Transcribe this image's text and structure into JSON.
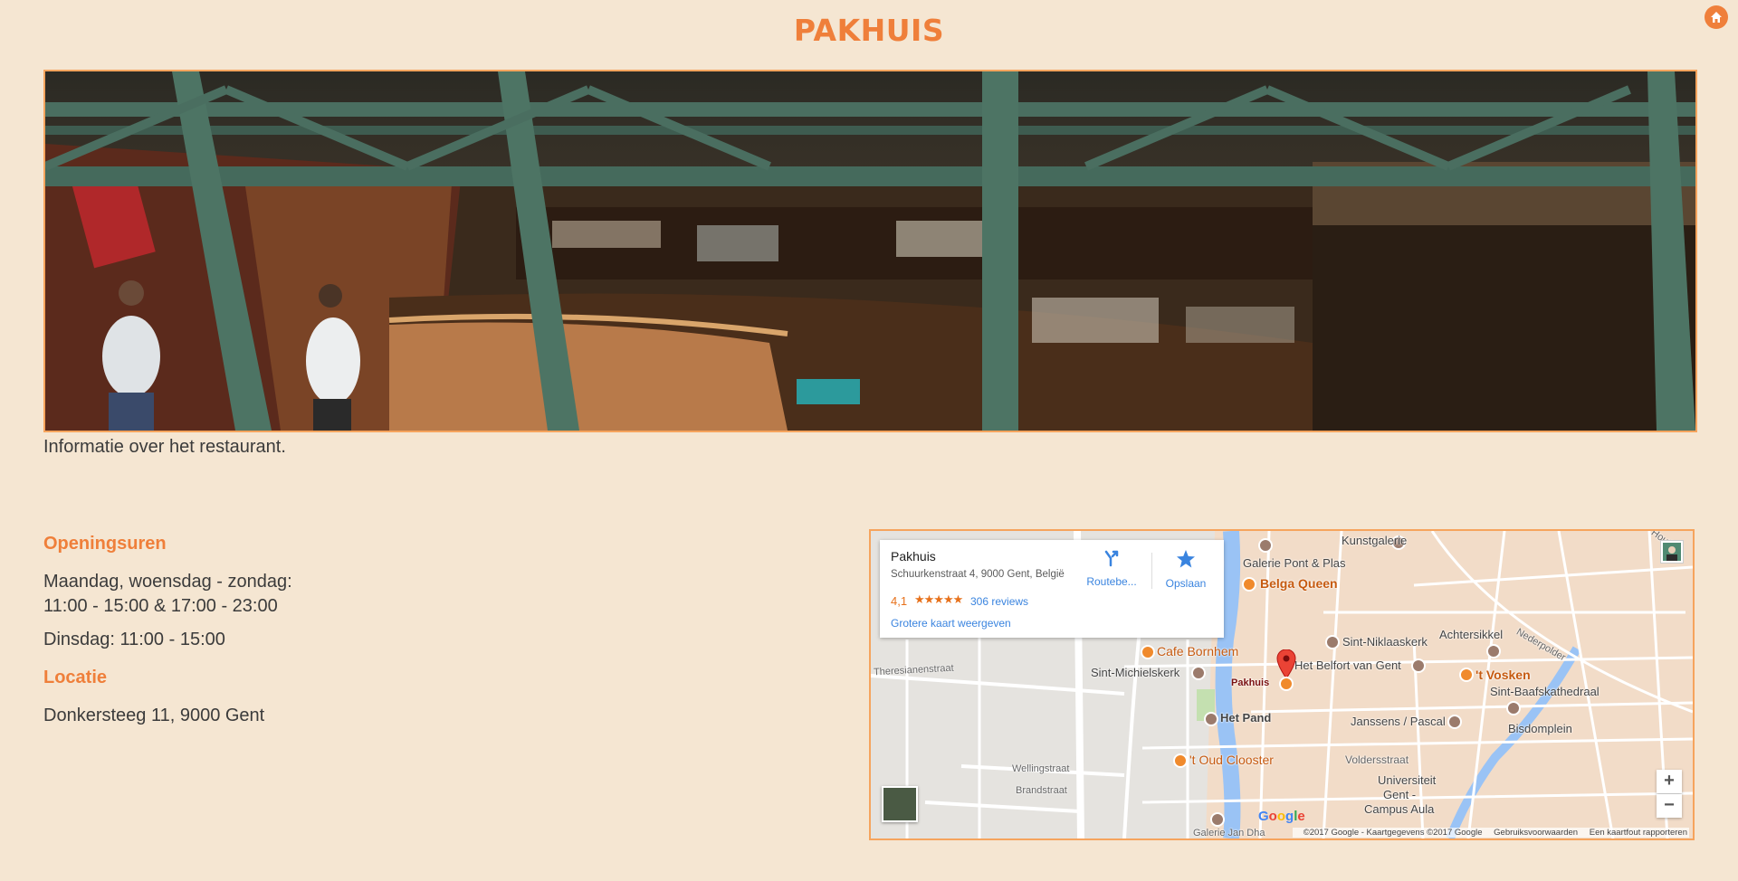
{
  "header": {
    "title": "PAKHUIS",
    "home_icon": "home-icon"
  },
  "hero": {
    "image": "restaurant-interior-photo"
  },
  "intro": {
    "text": "Informatie over het restaurant."
  },
  "hours": {
    "heading": "Openingsuren",
    "line1": "Maandag, woensdag - zondag:",
    "line2": "11:00 - 15:00 & 17:00 - 23:00",
    "line3": "Dinsdag: 11:00 - 15:00"
  },
  "location": {
    "heading": "Locatie",
    "address": "Donkersteeg 11, 9000 Gent"
  },
  "map": {
    "card": {
      "name": "Pakhuis",
      "address": "Schuurkenstraat 4, 9000 Gent, België",
      "rating": "4,1",
      "stars": "★★★★★",
      "reviews": "306 reviews",
      "larger_map": "Grotere kaart weergeven",
      "directions": "Routebe...",
      "save": "Opslaan"
    },
    "labels": {
      "kunstgalerie": "Kunstgalerie",
      "galerie_pont": "Galerie Pont & Plas",
      "belga_queen": "Belga Queen",
      "sint_niklaaskerk": "Sint-Niklaaskerk",
      "achtersikkel": "Achtersikkel",
      "cafe_bornhem": "Cafe Bornhem",
      "sint_michielskerk": "Sint-Michielskerk",
      "het_belfort": "Het Belfort van Gent",
      "t_vosken": "'t Vosken",
      "sint_baafs": "Sint-Baafskathedraal",
      "pakhuis": "Pakhuis",
      "het_pand": "Het Pand",
      "janssens": "Janssens / Pascal",
      "bisdomplein": "Bisdomplein",
      "oud_clooster": "'t Oud Clooster",
      "voldersstraat": "Voldersstraat",
      "universiteit": "Universiteit",
      "gent": "Gent -",
      "campus_aula": "Campus Aula",
      "theresianenstraat": "Theresianenstraat",
      "wellingstraat": "Wellingstraat",
      "brandstraat": "Brandstraat",
      "galerie_jan": "Galerie Jan Dha",
      "nederpolder": "Nederpolder",
      "houtbriel": "Houtbri"
    },
    "google": "Google",
    "attribution": {
      "copyright": "©2017 Google - Kaartgegevens ©2017 Google",
      "terms": "Gebruiksvoorwaarden",
      "report": "Een kaartfout rapporteren"
    },
    "zoom_in": "+",
    "zoom_out": "−"
  }
}
